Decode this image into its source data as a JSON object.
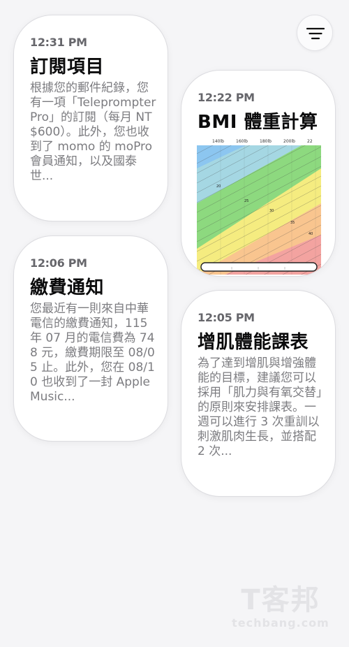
{
  "cards": [
    {
      "time": "12:31 PM",
      "title": "訂閱項目",
      "body": "根據您的郵件紀錄，您有一項「Teleprompter Pro」的訂閱（每月 NT$600）。此外，您也收到了 momo 的 moPro 會員通知，以及國泰世..."
    },
    {
      "time": "12:22 PM",
      "title": "BMI 體重計算",
      "chart_labels": {
        "top_axis": [
          "140lb",
          "160lb",
          "180lb",
          "200lb",
          "22"
        ],
        "bands": [
          "20",
          "25",
          "30",
          "35",
          "40"
        ]
      }
    },
    {
      "time": "12:06 PM",
      "title": "繳費通知",
      "body": "您最近有一則來自中華電信的繳費通知，115 年 07 月的電信費為 748 元，繳費期限至 08/05 止。此外，您在 08/10 也收到了一封 Apple Music..."
    },
    {
      "time": "12:05 PM",
      "title": "增肌體能課表",
      "body": "為了達到增肌與增強體能的目標，建議您可以採用「肌力與有氧交替」的原則來安排課表。一週可以進行 3 次重訓以刺激肌肉生長，並搭配 2 次..."
    }
  ],
  "watermark": {
    "logo": "T客邦",
    "url": "techbang.com"
  }
}
